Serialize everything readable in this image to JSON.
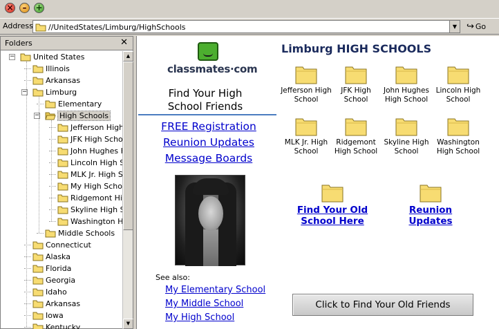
{
  "window": {
    "close_glyph": "×",
    "min_glyph": "–",
    "max_glyph": "+"
  },
  "address": {
    "label": "Address",
    "value": "//UnitedStates/Limburg/HighSchools",
    "go": "Go"
  },
  "folders": {
    "title": "Folders",
    "close": "✕",
    "tree": [
      {
        "label": "United States",
        "level": 1,
        "expander": "−"
      },
      {
        "label": "Illinois",
        "level": 2
      },
      {
        "label": "Arkansas",
        "level": 2
      },
      {
        "label": "Limburg",
        "level": 2,
        "expander": "−"
      },
      {
        "label": "Elementary",
        "level": 3
      },
      {
        "label": "High Schools",
        "level": 3,
        "expander": "−",
        "selected": true,
        "open": true
      },
      {
        "label": "Jefferson High",
        "level": 4
      },
      {
        "label": "JFK High Schoc",
        "level": 4
      },
      {
        "label": "John Hughes H",
        "level": 4
      },
      {
        "label": "Lincoln High Sch",
        "level": 4
      },
      {
        "label": "MLK Jr. High Sc",
        "level": 4
      },
      {
        "label": "My High School",
        "level": 4
      },
      {
        "label": "Ridgemont High",
        "level": 4
      },
      {
        "label": "Skyline High Sc",
        "level": 4
      },
      {
        "label": "Washington Hig",
        "level": 4
      },
      {
        "label": "Middle Schools",
        "level": 3
      },
      {
        "label": "Connecticut",
        "level": 2
      },
      {
        "label": "Alaska",
        "level": 2
      },
      {
        "label": "Florida",
        "level": 2
      },
      {
        "label": "Georgia",
        "level": 2
      },
      {
        "label": "Idaho",
        "level": 2
      },
      {
        "label": "Arkansas",
        "level": 2
      },
      {
        "label": "Iowa",
        "level": 2
      },
      {
        "label": "Kentucky",
        "level": 2
      }
    ]
  },
  "left": {
    "logo": "classmates·com",
    "find_title_1": "Find Your High",
    "find_title_2": "School Friends",
    "links": [
      "FREE Registration",
      "Reunion Updates",
      "Message Boards"
    ],
    "see_also": "See also:",
    "small_links": [
      "My Elementary School",
      "My Middle School",
      "My High School"
    ]
  },
  "right": {
    "title": "Limburg HIGH SCHOOLS",
    "schools": [
      [
        "Jefferson High",
        "School"
      ],
      [
        "JFK High",
        "School"
      ],
      [
        "John Hughes",
        "High School"
      ],
      [
        "Lincoln High",
        "School"
      ],
      [
        "MLK Jr. High",
        "School"
      ],
      [
        "Ridgemont",
        "High School"
      ],
      [
        "Skyline High",
        "School"
      ],
      [
        "Washington",
        "High School"
      ]
    ],
    "mid_links": [
      [
        "Find Your Old",
        "School Here"
      ],
      [
        "Reunion",
        "Updates"
      ]
    ],
    "cta": "Click to Find Your Old Friends"
  },
  "colors": {
    "folder_fill": "#f7dc72",
    "folder_stroke": "#8a7320",
    "link": "#0000cc",
    "title": "#1a2a5c",
    "logo_green": "#4cae2f"
  }
}
